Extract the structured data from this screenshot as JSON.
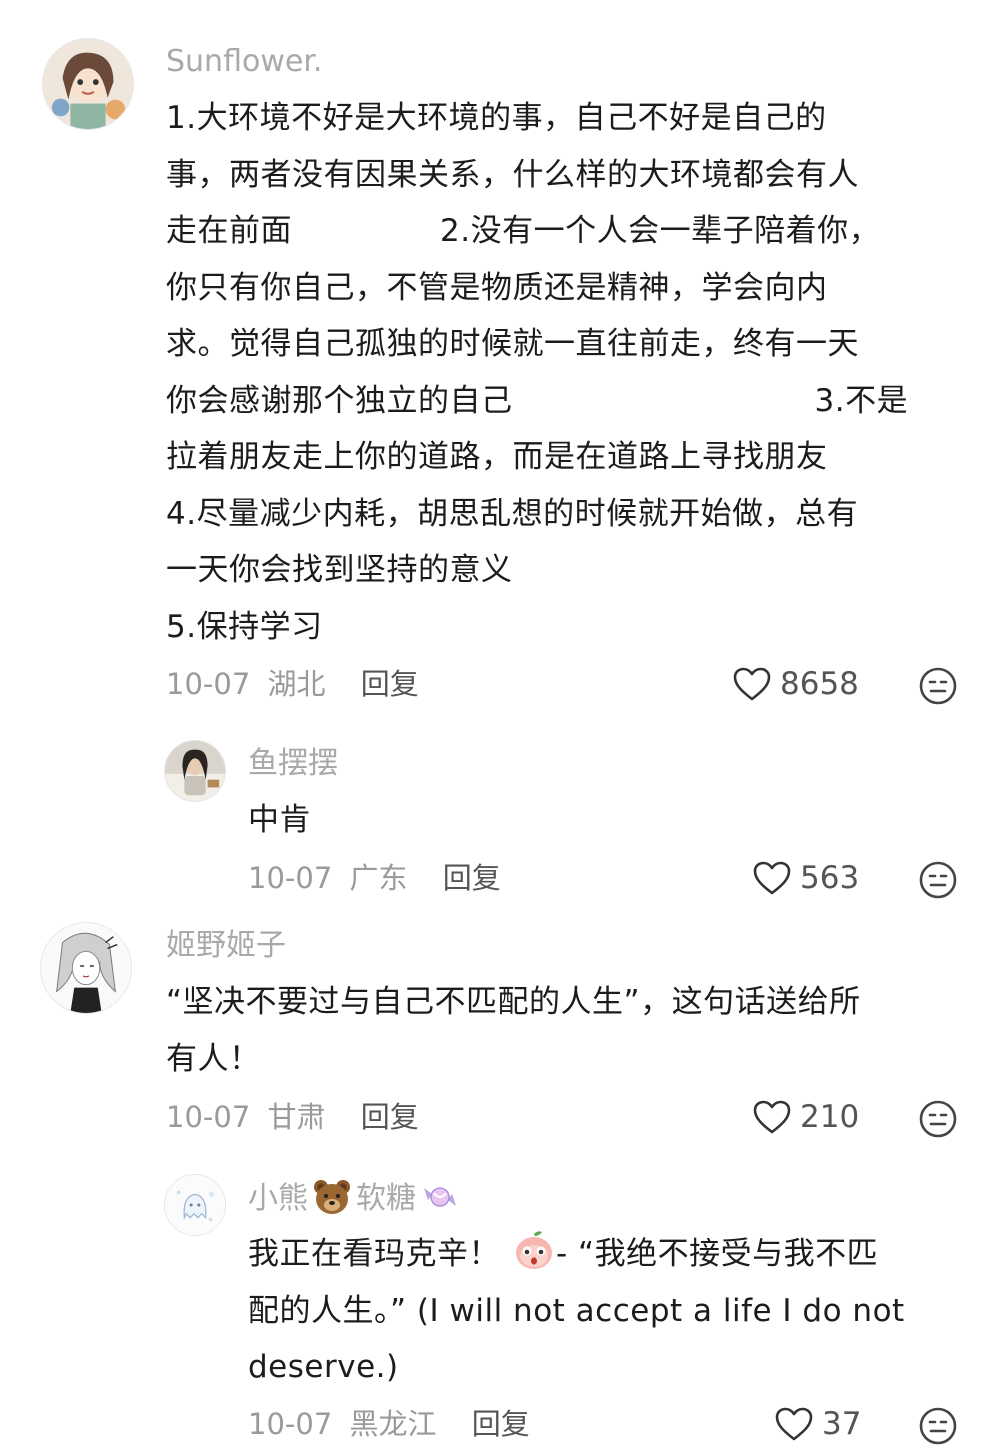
{
  "comments": [
    {
      "username": "Sunflower.",
      "lines": [
        "1.大环境不好是大环境的事，自己不好是自己的",
        "事，两者没有因果关系，什么样的大环境都会有人",
        "走在前面",
        "2.没有一个人会一辈子陪着你，",
        "你只有你自己，不管是物质还是精神，学会向内",
        "求。觉得自己孤独的时候就一直往前走，终有一天",
        "你会感谢那个独立的自己",
        "3.不是",
        "拉着朋友走上你的道路，而是在道路上寻找朋友",
        "4.尽量减少内耗，胡思乱想的时候就开始做，总有",
        "一天你会找到坚持的意义",
        "5.保持学习"
      ],
      "date": "10-07",
      "location": "湖北",
      "reply_label": "回复",
      "likes": "8658",
      "avatar_icon": "illustrated-girl-avatar",
      "reply": {
        "username": "鱼摆摆",
        "text": "中肯",
        "date": "10-07",
        "location": "广东",
        "reply_label": "回复",
        "likes": "563",
        "avatar_icon": "girl-photo-avatar"
      }
    },
    {
      "username": "姬野姬子",
      "lines": [
        "“坚决不要过与自己不匹配的人生”，这句话送给所",
        "有人！"
      ],
      "date": "10-07",
      "location": "甘肃",
      "reply_label": "回复",
      "likes": "210",
      "avatar_icon": "sketch-girl-avatar",
      "reply": {
        "username_part1": "小熊",
        "username_emoji": "bear-face-emoji",
        "username_part2": "软糖",
        "username_emoji2": "candy-emoji",
        "line1_a": "我正在看玛克辛！",
        "line1_emoji": "peach-face-emoji",
        "line1_b": "- “我绝不接受与我不匹",
        "line2": "配的人生。” (I will not accept a life I do not",
        "line3": "deserve.)",
        "date": "10-07",
        "location": "黑龙江",
        "reply_label": "回复",
        "likes": "37",
        "avatar_icon": "ghost-doodle-avatar"
      }
    }
  ],
  "icons": {
    "like": "heart-outline-icon",
    "react": "face-emoji-icon"
  }
}
